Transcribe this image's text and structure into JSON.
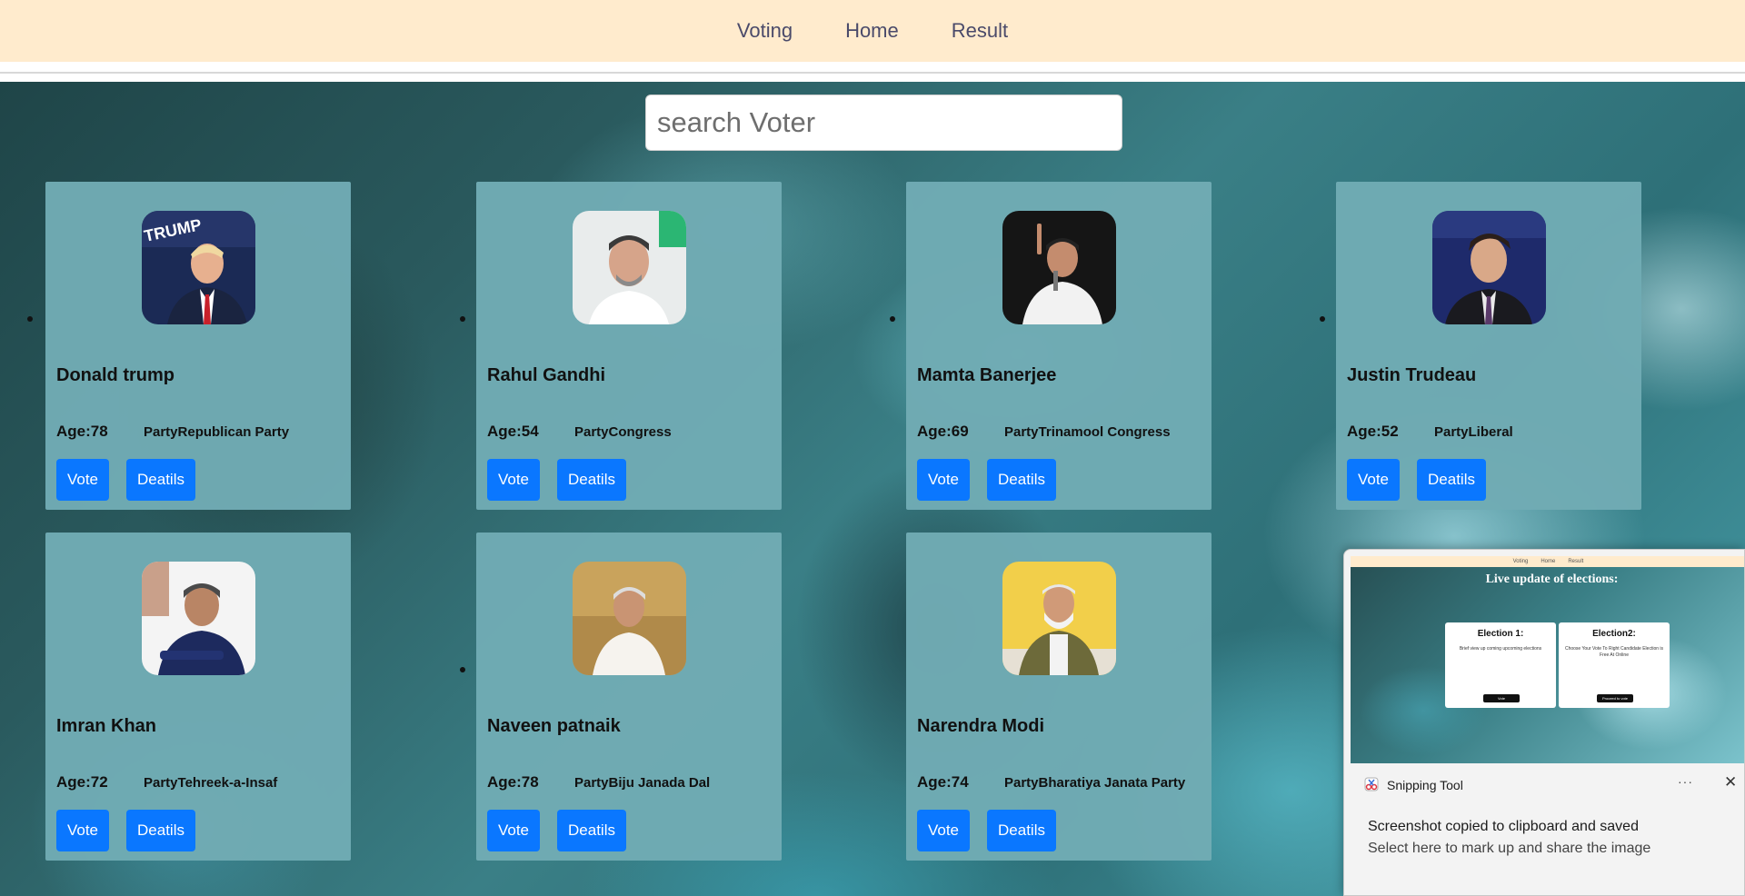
{
  "nav": {
    "items": [
      {
        "label": "Voting"
      },
      {
        "label": "Home"
      },
      {
        "label": "Result"
      }
    ]
  },
  "search": {
    "placeholder": "search Voter",
    "value": ""
  },
  "candidates": [
    {
      "name": "Donald trump",
      "age": "Age:78",
      "party": "PartyRepublican Party",
      "vote_label": "Vote",
      "details_label": "Deatils"
    },
    {
      "name": "Rahul Gandhi",
      "age": "Age:54",
      "party": "PartyCongress",
      "vote_label": "Vote",
      "details_label": "Deatils"
    },
    {
      "name": "Mamta Banerjee",
      "age": "Age:69",
      "party": "PartyTrinamool Congress",
      "vote_label": "Vote",
      "details_label": "Deatils"
    },
    {
      "name": "Justin Trudeau",
      "age": "Age:52",
      "party": "PartyLiberal",
      "vote_label": "Vote",
      "details_label": "Deatils"
    },
    {
      "name": "Imran Khan",
      "age": "Age:72",
      "party": "PartyTehreek-a-Insaf",
      "vote_label": "Vote",
      "details_label": "Deatils"
    },
    {
      "name": "Naveen patnaik",
      "age": "Age:78",
      "party": "PartyBiju Janada Dal",
      "vote_label": "Vote",
      "details_label": "Deatils"
    },
    {
      "name": "Narendra Modi",
      "age": "Age:74",
      "party": "PartyBharatiya Janata Party",
      "vote_label": "Vote",
      "details_label": "Deatils"
    }
  ],
  "toast": {
    "app_name": "Snipping Tool",
    "more_label": "···",
    "close_label": "✕",
    "message_line1": "Screenshot copied to clipboard and saved",
    "message_line2": "Select here to mark up and share the image",
    "preview": {
      "nav": [
        "Voting",
        "Home",
        "Result"
      ],
      "title": "Live update of elections:",
      "cards": [
        {
          "heading": "Election 1:",
          "text": "Brief view up coming upcoming elections",
          "button": "Vote"
        },
        {
          "heading": "Election2:",
          "text": "Choose Your Vote To Right Candidate  Election is Free At Online",
          "button": "Proceed to vote"
        }
      ]
    }
  },
  "colors": {
    "nav_bg": "#ffebcd",
    "card_bg": "#71abb4",
    "button_bg": "#0a77ff"
  }
}
